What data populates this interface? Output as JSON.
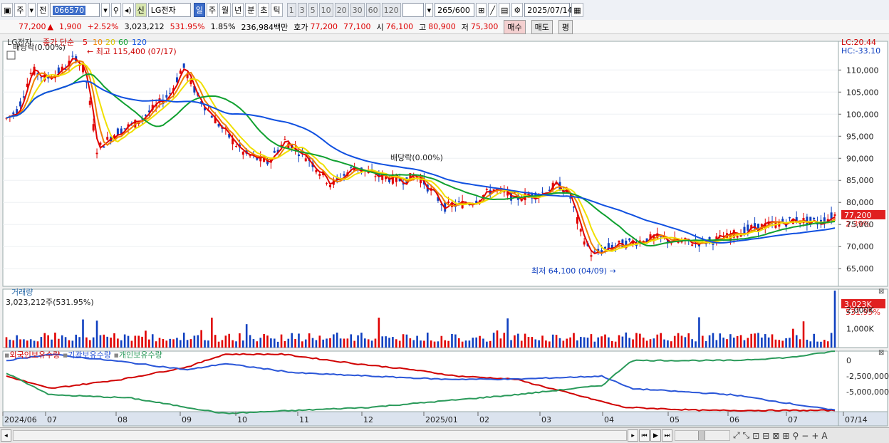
{
  "toolbar": {
    "mode": "주",
    "prev": "전",
    "code": "066570",
    "credit_badge": "신",
    "stock_name": "LG전자",
    "periods": [
      "일",
      "주",
      "월",
      "년",
      "분",
      "초",
      "틱"
    ],
    "intervals": [
      "1",
      "3",
      "5",
      "10",
      "20",
      "30",
      "60",
      "120"
    ],
    "count": "265",
    "count_total": "/600",
    "date": "2025/07/14"
  },
  "quote": {
    "price": "77,200",
    "change": "1,900",
    "change_pct": "+2.52%",
    "volume": "3,023,212",
    "volume_ratio": "531.95%",
    "turnover": "1.85%",
    "amount": "236,984백만",
    "bid_label": "호가",
    "ask": "77,200",
    "bid": "77,100",
    "open_label": "시",
    "open": "76,100",
    "high_label": "고",
    "high": "80,900",
    "low_label": "저",
    "low": "75,300",
    "buy": "매수",
    "sell": "매도",
    "extra": "평"
  },
  "price_panel": {
    "title": "LG전자",
    "ma_label": "종가 단순",
    "ma_periods": [
      "5",
      "10",
      "20",
      "60",
      "120"
    ],
    "dividend_top": "배당락(0.00%)",
    "dividend_mid": "배당락(0.00%)",
    "high_note": "최고 115,400 (07/17)",
    "low_note": "최저 64,100 (04/09)",
    "lc": "LC:20.44",
    "hc": "HC:-33.10",
    "current_tag": "77,200",
    "current_pct": "2.39%",
    "y_labels": [
      "110,000",
      "105,000",
      "100,000",
      "95,000",
      "90,000",
      "85,000",
      "80,000",
      "75,000",
      "70,000",
      "65,000"
    ]
  },
  "volume_panel": {
    "title": "거래량",
    "value": "3,023,212주(531.95%)",
    "current_tag": "3,023K",
    "current_pct": "531.95%",
    "y_labels": [
      "2,000K",
      "1,000K"
    ]
  },
  "holding_panel": {
    "labels": [
      "외국인보유수량",
      "기관보유수량",
      "개인보유수량"
    ],
    "y_labels": [
      "0",
      "-2,500,000",
      "-5,000,000"
    ]
  },
  "x_axis": [
    "2024/06",
    "07",
    "08",
    "09",
    "10",
    "11",
    "12",
    "2025/01",
    "02",
    "03",
    "04",
    "05",
    "06",
    "07",
    "07/14"
  ],
  "colors": {
    "ma5": "#e00000",
    "ma10": "#f08000",
    "ma20": "#f0e000",
    "ma60": "#10a030",
    "ma120": "#1050e0",
    "up": "#e00000",
    "down": "#1040c0",
    "foreign": "#d00000",
    "institution": "#2a56d8",
    "individual": "#2a9a5a"
  }
}
